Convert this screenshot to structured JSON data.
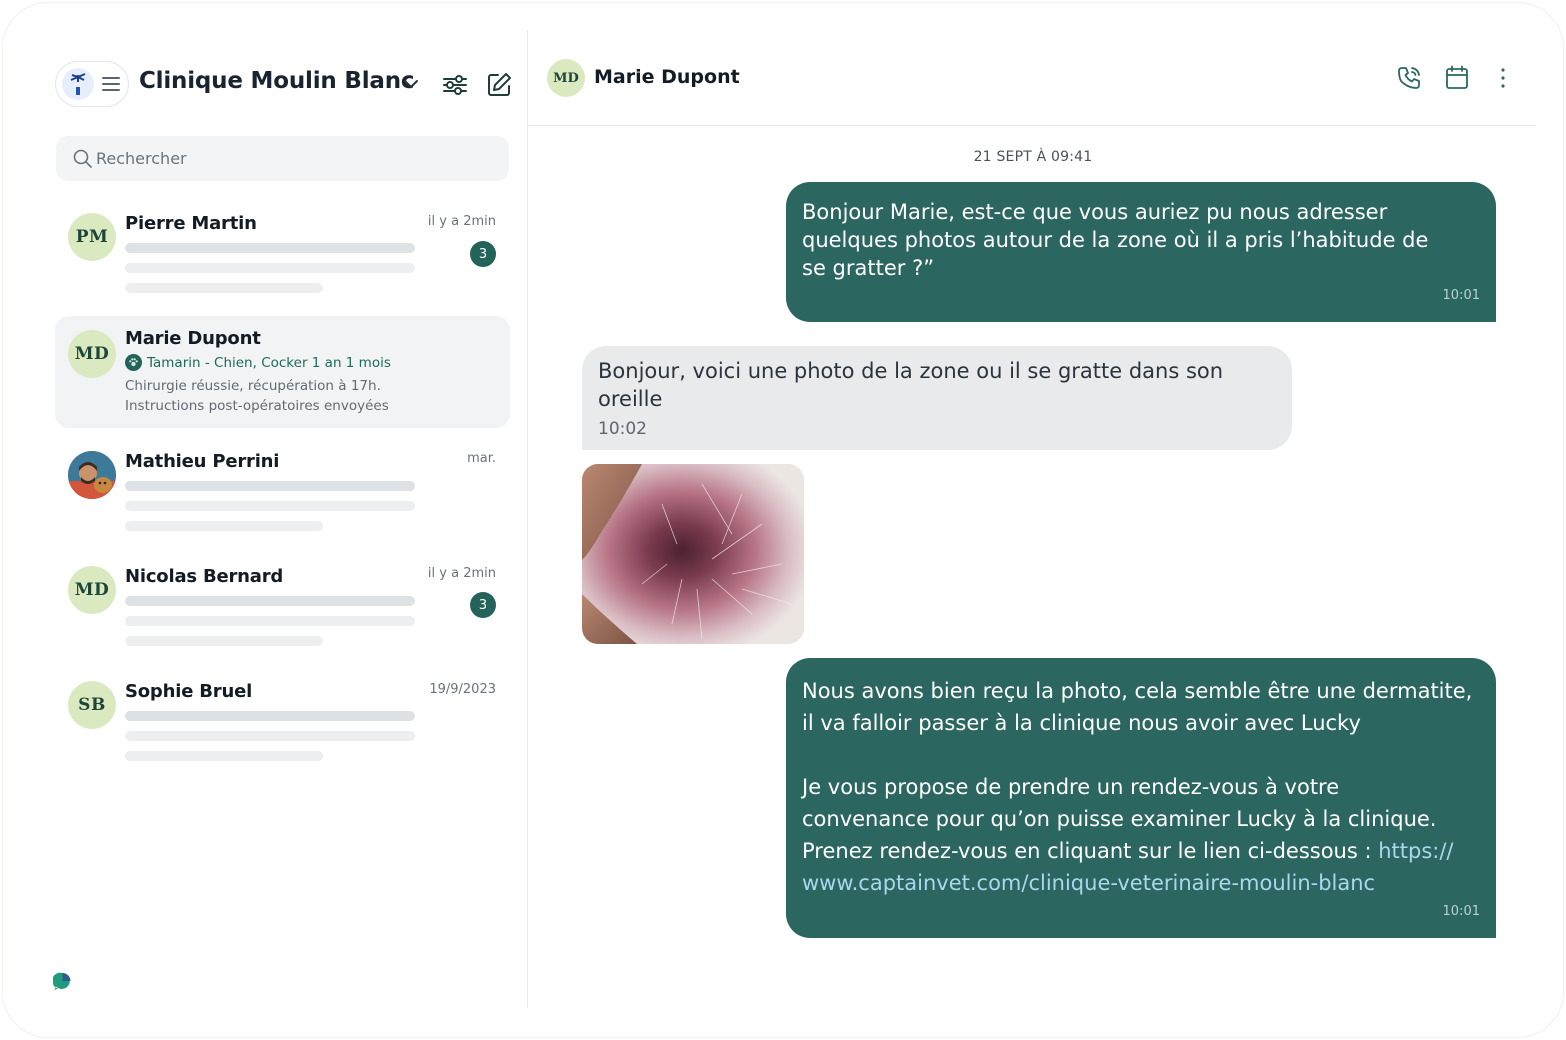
{
  "colors": {
    "accent": "#2b6760",
    "avatar_bg": "#dbe9c0",
    "incoming_bubble": "#e8eaec",
    "badge": "#23635a"
  },
  "header": {
    "clinic_name": "Clinique Moulin Blanc"
  },
  "search": {
    "placeholder": "Rechercher"
  },
  "conversations": [
    {
      "initials": "PM",
      "name": "Pierre Martin",
      "time": "il y a 2min",
      "unread": "3"
    },
    {
      "initials": "MD",
      "name": "Marie Dupont",
      "pet": "Tamarin - Chien, Cocker 1 an 1 mois",
      "preview_line1": "Chirurgie réussie, récupération à 17h.",
      "preview_line2": "Instructions post-opératoires envoyées",
      "active": true
    },
    {
      "name": "Mathieu Perrini",
      "time": "mar.",
      "avatar": "photo"
    },
    {
      "initials": "MD",
      "name": "Nicolas Bernard",
      "time": "il y a 2min",
      "unread": "3"
    },
    {
      "initials": "SB",
      "name": "Sophie Bruel",
      "time": "19/9/2023"
    }
  ],
  "chat": {
    "contact_initials": "MD",
    "contact_name": "Marie Dupont",
    "date_separator": "21 SEPT À 09:41",
    "messages": [
      {
        "direction": "out",
        "lines": [
          "Bonjour Marie, est-ce que vous auriez pu nous adresser",
          "quelques photos autour de la zone où il a pris l’habitude de",
          "se gratter ?”"
        ],
        "time": "10:01"
      },
      {
        "direction": "in",
        "lines": [
          "Bonjour, voici une photo de la zone ou il se gratte dans son",
          "oreille"
        ],
        "time": "10:02"
      },
      {
        "direction": "in",
        "type": "photo"
      },
      {
        "direction": "out",
        "lines": [
          "Nous avons bien reçu la photo, cela semble être une dermatite,",
          "il va falloir passer à la clinique nous avoir avec Lucky",
          "Je vous propose de prendre un rendez-vous à votre",
          "convenance pour qu’on puisse examiner Lucky à la clinique.",
          "Prenez rendez-vous en cliquant sur le lien ci-dessous : "
        ],
        "link_part1": "https://",
        "link_part2": "www.captainvet.com/clinique-veterinaire-moulin-blanc",
        "time": "10:01"
      }
    ]
  }
}
